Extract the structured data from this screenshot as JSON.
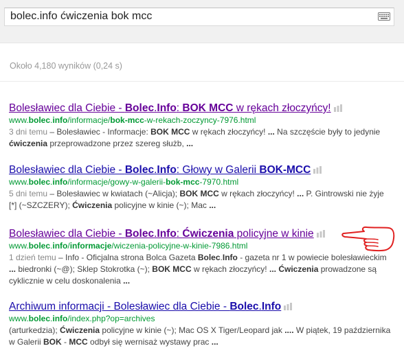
{
  "search": {
    "query": "bolec.info ćwiczenia bok mcc",
    "keyboard_icon": "keyboard-icon"
  },
  "stats": "Około 4,180 wyników (0,24 s)",
  "colors": {
    "visited_link": "#660099",
    "unvisited_link": "#1a0dab",
    "url_green": "#009933",
    "annotation_red": "#e02020"
  },
  "results": [
    {
      "title": [
        {
          "t": "Bolesławiec dla Ciebie - ",
          "b": false
        },
        {
          "t": "Bolec",
          "b": true
        },
        {
          "t": ".",
          "b": false
        },
        {
          "t": "Info",
          "b": true
        },
        {
          "t": ": ",
          "b": false
        },
        {
          "t": "BOK MCC",
          "b": true
        },
        {
          "t": " w rękach złoczyńcy!",
          "b": false
        }
      ],
      "url": [
        {
          "t": "www.",
          "b": false
        },
        {
          "t": "bolec",
          "b": true
        },
        {
          "t": ".",
          "b": false
        },
        {
          "t": "info",
          "b": true
        },
        {
          "t": "/informacje/",
          "b": false
        },
        {
          "t": "bok-mcc",
          "b": true
        },
        {
          "t": "-w-rekach-zoczyncy-7976.html",
          "b": false
        }
      ],
      "snippet": [
        {
          "t": "3 dni temu",
          "d": true
        },
        {
          "t": " – Bolesławiec - Informacje: ",
          "b": false
        },
        {
          "t": "BOK MCC",
          "b": true
        },
        {
          "t": " w rękach złoczyńcy! ",
          "b": false
        },
        {
          "t": "...",
          "b": true
        },
        {
          "t": " Na szczęście były to jedynie ",
          "b": false
        },
        {
          "t": "ćwiczenia",
          "b": true
        },
        {
          "t": " przeprowadzone przez szereg służb, ",
          "b": false
        },
        {
          "t": "...",
          "b": true
        }
      ]
    },
    {
      "title": [
        {
          "t": "Bolesławiec dla Ciebie - ",
          "b": false
        },
        {
          "t": "Bolec",
          "b": true
        },
        {
          "t": ".",
          "b": false
        },
        {
          "t": "Info",
          "b": true
        },
        {
          "t": ": Głowy w Galerii ",
          "b": false
        },
        {
          "t": "BOK-MCC",
          "b": true
        }
      ],
      "url": [
        {
          "t": "www.",
          "b": false
        },
        {
          "t": "bolec",
          "b": true
        },
        {
          "t": ".",
          "b": false
        },
        {
          "t": "info",
          "b": true
        },
        {
          "t": "/informacje/gowy-w-galerii-",
          "b": false
        },
        {
          "t": "bok-mcc",
          "b": true
        },
        {
          "t": "-7970.html",
          "b": false
        }
      ],
      "snippet": [
        {
          "t": "5 dni temu",
          "d": true
        },
        {
          "t": " – Bolesławiec w kwiatach (~Alicja); ",
          "b": false
        },
        {
          "t": "BOK MCC",
          "b": true
        },
        {
          "t": " w rękach złoczyńcy! ",
          "b": false
        },
        {
          "t": "...",
          "b": true
        },
        {
          "t": " P. Gintrowski nie żyje [*] (~SZCZERY); ",
          "b": false
        },
        {
          "t": "Ćwiczenia",
          "b": true
        },
        {
          "t": " policyjne w kinie (~); Mac ",
          "b": false
        },
        {
          "t": "...",
          "b": true
        }
      ]
    },
    {
      "title": [
        {
          "t": "Bolesławiec dla Ciebie - ",
          "b": false
        },
        {
          "t": "Bolec",
          "b": true
        },
        {
          "t": ".",
          "b": false
        },
        {
          "t": "Info",
          "b": true
        },
        {
          "t": ": ",
          "b": false
        },
        {
          "t": "Ćwiczenia",
          "b": true
        },
        {
          "t": " policyjne w kinie",
          "b": false
        }
      ],
      "url": [
        {
          "t": "www.",
          "b": false
        },
        {
          "t": "bolec",
          "b": true
        },
        {
          "t": ".",
          "b": false
        },
        {
          "t": "info",
          "b": true
        },
        {
          "t": "/",
          "b": false
        },
        {
          "t": "informacje",
          "b": true
        },
        {
          "t": "/wiczenia-policyjne-w-kinie-7986.html",
          "b": false
        }
      ],
      "snippet": [
        {
          "t": "1 dzień temu",
          "d": true
        },
        {
          "t": " – Info - Oficjalna strona Bolca Gazeta ",
          "b": false
        },
        {
          "t": "Bolec",
          "b": true
        },
        {
          "t": ".",
          "b": false
        },
        {
          "t": "Info",
          "b": true
        },
        {
          "t": " - gazeta nr 1 w powiecie bolesławieckim ",
          "b": false
        },
        {
          "t": "...",
          "b": true
        },
        {
          "t": " biedronki (~@); Sklep Stokrotka (~); ",
          "b": false
        },
        {
          "t": "BOK MCC",
          "b": true
        },
        {
          "t": " w rękach złoczyńcy! ",
          "b": false
        },
        {
          "t": "...",
          "b": true
        },
        {
          "t": " ",
          "b": false
        },
        {
          "t": "Ćwiczenia",
          "b": true
        },
        {
          "t": " prowadzone są cyklicznie w celu doskonalenia ",
          "b": false
        },
        {
          "t": "...",
          "b": true
        }
      ]
    },
    {
      "title": [
        {
          "t": "Archiwum informacji - Bolesławiec dla Ciebie - ",
          "b": false
        },
        {
          "t": "Bolec",
          "b": true
        },
        {
          "t": ".",
          "b": false
        },
        {
          "t": "Info",
          "b": true
        }
      ],
      "url": [
        {
          "t": "www.",
          "b": false
        },
        {
          "t": "bolec",
          "b": true
        },
        {
          "t": ".",
          "b": false
        },
        {
          "t": "info",
          "b": true
        },
        {
          "t": "/index.php?op=archives",
          "b": false
        }
      ],
      "snippet": [
        {
          "t": "(arturkedzia); ",
          "b": false
        },
        {
          "t": "Ćwiczenia",
          "b": true
        },
        {
          "t": " policyjne w kinie (~); Mac OS X Tiger/Leopard jak ",
          "b": false
        },
        {
          "t": "....",
          "b": true
        },
        {
          "t": " W piątek, 19 października w Galerii ",
          "b": false
        },
        {
          "t": "BOK",
          "b": true
        },
        {
          "t": " - ",
          "b": false
        },
        {
          "t": "MCC",
          "b": true
        },
        {
          "t": " odbył się wernisaż wystawy prac ",
          "b": false
        },
        {
          "t": "...",
          "b": true
        }
      ]
    }
  ]
}
